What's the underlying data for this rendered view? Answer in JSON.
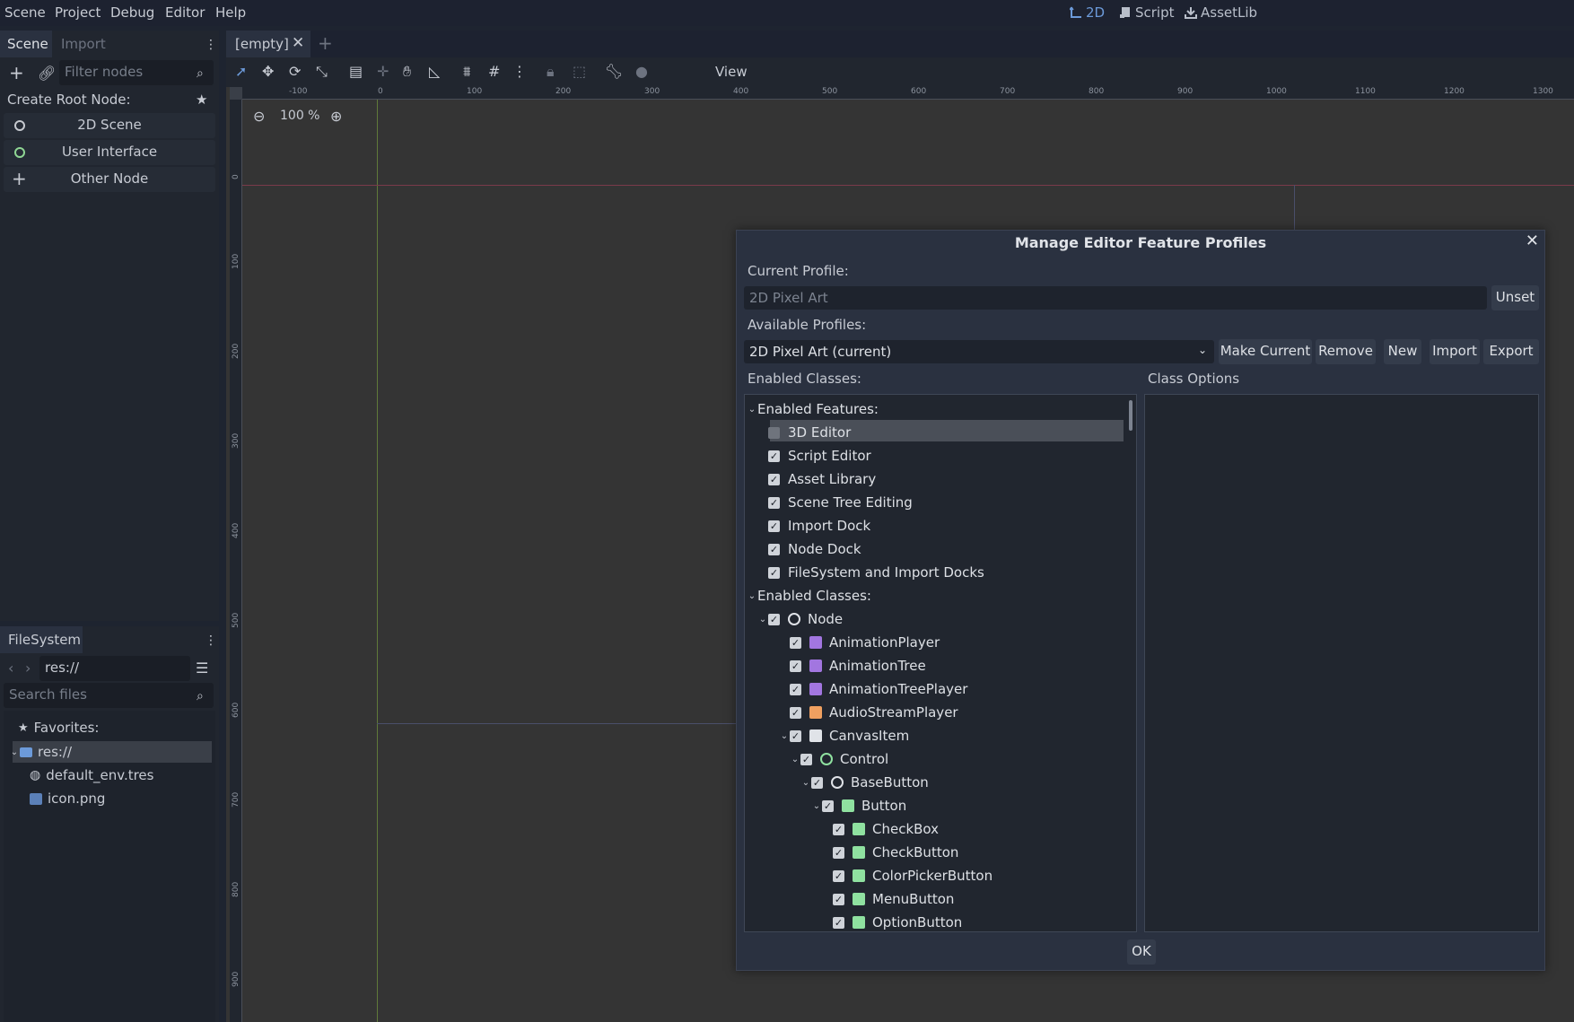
{
  "menu": [
    "Scene",
    "Project",
    "Debug",
    "Editor",
    "Help"
  ],
  "modes": [
    {
      "label": "2D",
      "icon": "2d-icon",
      "active": true
    },
    {
      "label": "Script",
      "icon": "script-icon"
    },
    {
      "label": "AssetLib",
      "icon": "assetlib-icon"
    }
  ],
  "scene_dock": {
    "tabs": [
      "Scene",
      "Import"
    ],
    "filter_placeholder": "Filter nodes",
    "create_root_label": "Create Root Node:",
    "root_buttons": [
      "2D Scene",
      "User Interface",
      "Other Node"
    ]
  },
  "fs_dock": {
    "tab": "FileSystem",
    "path": "res://",
    "search_placeholder": "Search files",
    "tree": [
      {
        "label": "Favorites:",
        "icon": "star-icon"
      },
      {
        "label": "res://",
        "icon": "folder-icon"
      },
      {
        "label": "default_env.tres",
        "icon": "globe-icon"
      },
      {
        "label": "icon.png",
        "icon": "image-icon"
      }
    ]
  },
  "editor": {
    "tab": "[empty]",
    "view_menu": "View",
    "zoom": "100 %",
    "ruler_labels": [
      "-100",
      "0",
      "100",
      "200",
      "300",
      "400",
      "500",
      "600",
      "700",
      "800",
      "900",
      "1000",
      "1100",
      "1200",
      "1300"
    ],
    "vruler_labels": [
      "0",
      "100",
      "200",
      "300",
      "400",
      "500",
      "600",
      "700",
      "800",
      "900"
    ]
  },
  "dialog": {
    "title": "Manage Editor Feature Profiles",
    "current_profile_label": "Current Profile:",
    "current_profile_value": "2D Pixel Art",
    "unset": "Unset",
    "available_label": "Available Profiles:",
    "available_value": "2D Pixel Art (current)",
    "buttons": [
      "Make Current",
      "Remove",
      "New",
      "Import",
      "Export"
    ],
    "enabled_classes_label": "Enabled Classes:",
    "class_options_label": "Class Options",
    "ok": "OK",
    "tree": [
      {
        "label": "Enabled Features:",
        "level": 0,
        "arrow": true,
        "checkbox": false
      },
      {
        "label": "3D Editor",
        "level": 1,
        "checkbox": true,
        "checked": false,
        "selected": true
      },
      {
        "label": "Script Editor",
        "level": 1,
        "checkbox": true,
        "checked": true
      },
      {
        "label": "Asset Library",
        "level": 1,
        "checkbox": true,
        "checked": true
      },
      {
        "label": "Scene Tree Editing",
        "level": 1,
        "checkbox": true,
        "checked": true
      },
      {
        "label": "Import Dock",
        "level": 1,
        "checkbox": true,
        "checked": true
      },
      {
        "label": "Node Dock",
        "level": 1,
        "checkbox": true,
        "checked": true
      },
      {
        "label": "FileSystem and Import Docks",
        "level": 1,
        "checkbox": true,
        "checked": true
      },
      {
        "label": "Enabled Classes:",
        "level": 0,
        "arrow": true,
        "checkbox": false
      },
      {
        "label": "Node",
        "level": 1,
        "arrow": true,
        "checkbox": true,
        "checked": true,
        "icon": "circle"
      },
      {
        "label": "AnimationPlayer",
        "level": 2,
        "checkbox": true,
        "checked": true,
        "icon": "purple"
      },
      {
        "label": "AnimationTree",
        "level": 2,
        "checkbox": true,
        "checked": true,
        "icon": "purple"
      },
      {
        "label": "AnimationTreePlayer",
        "level": 2,
        "checkbox": true,
        "checked": true,
        "icon": "purple"
      },
      {
        "label": "AudioStreamPlayer",
        "level": 2,
        "checkbox": true,
        "checked": true,
        "icon": "orange"
      },
      {
        "label": "CanvasItem",
        "level": 2,
        "arrow": true,
        "checkbox": true,
        "checked": true,
        "icon": "white"
      },
      {
        "label": "Control",
        "level": 3,
        "arrow": true,
        "checkbox": true,
        "checked": true,
        "icon": "green-circle"
      },
      {
        "label": "BaseButton",
        "level": 4,
        "arrow": true,
        "checkbox": true,
        "checked": true,
        "icon": "circle"
      },
      {
        "label": "Button",
        "level": 5,
        "arrow": true,
        "checkbox": true,
        "checked": true,
        "icon": "green"
      },
      {
        "label": "CheckBox",
        "level": 6,
        "checkbox": true,
        "checked": true,
        "icon": "green"
      },
      {
        "label": "CheckButton",
        "level": 6,
        "checkbox": true,
        "checked": true,
        "icon": "green"
      },
      {
        "label": "ColorPickerButton",
        "level": 6,
        "checkbox": true,
        "checked": true,
        "icon": "green"
      },
      {
        "label": "MenuButton",
        "level": 6,
        "checkbox": true,
        "checked": true,
        "icon": "green"
      },
      {
        "label": "OptionButton",
        "level": 6,
        "checkbox": true,
        "checked": true,
        "icon": "green"
      }
    ]
  }
}
